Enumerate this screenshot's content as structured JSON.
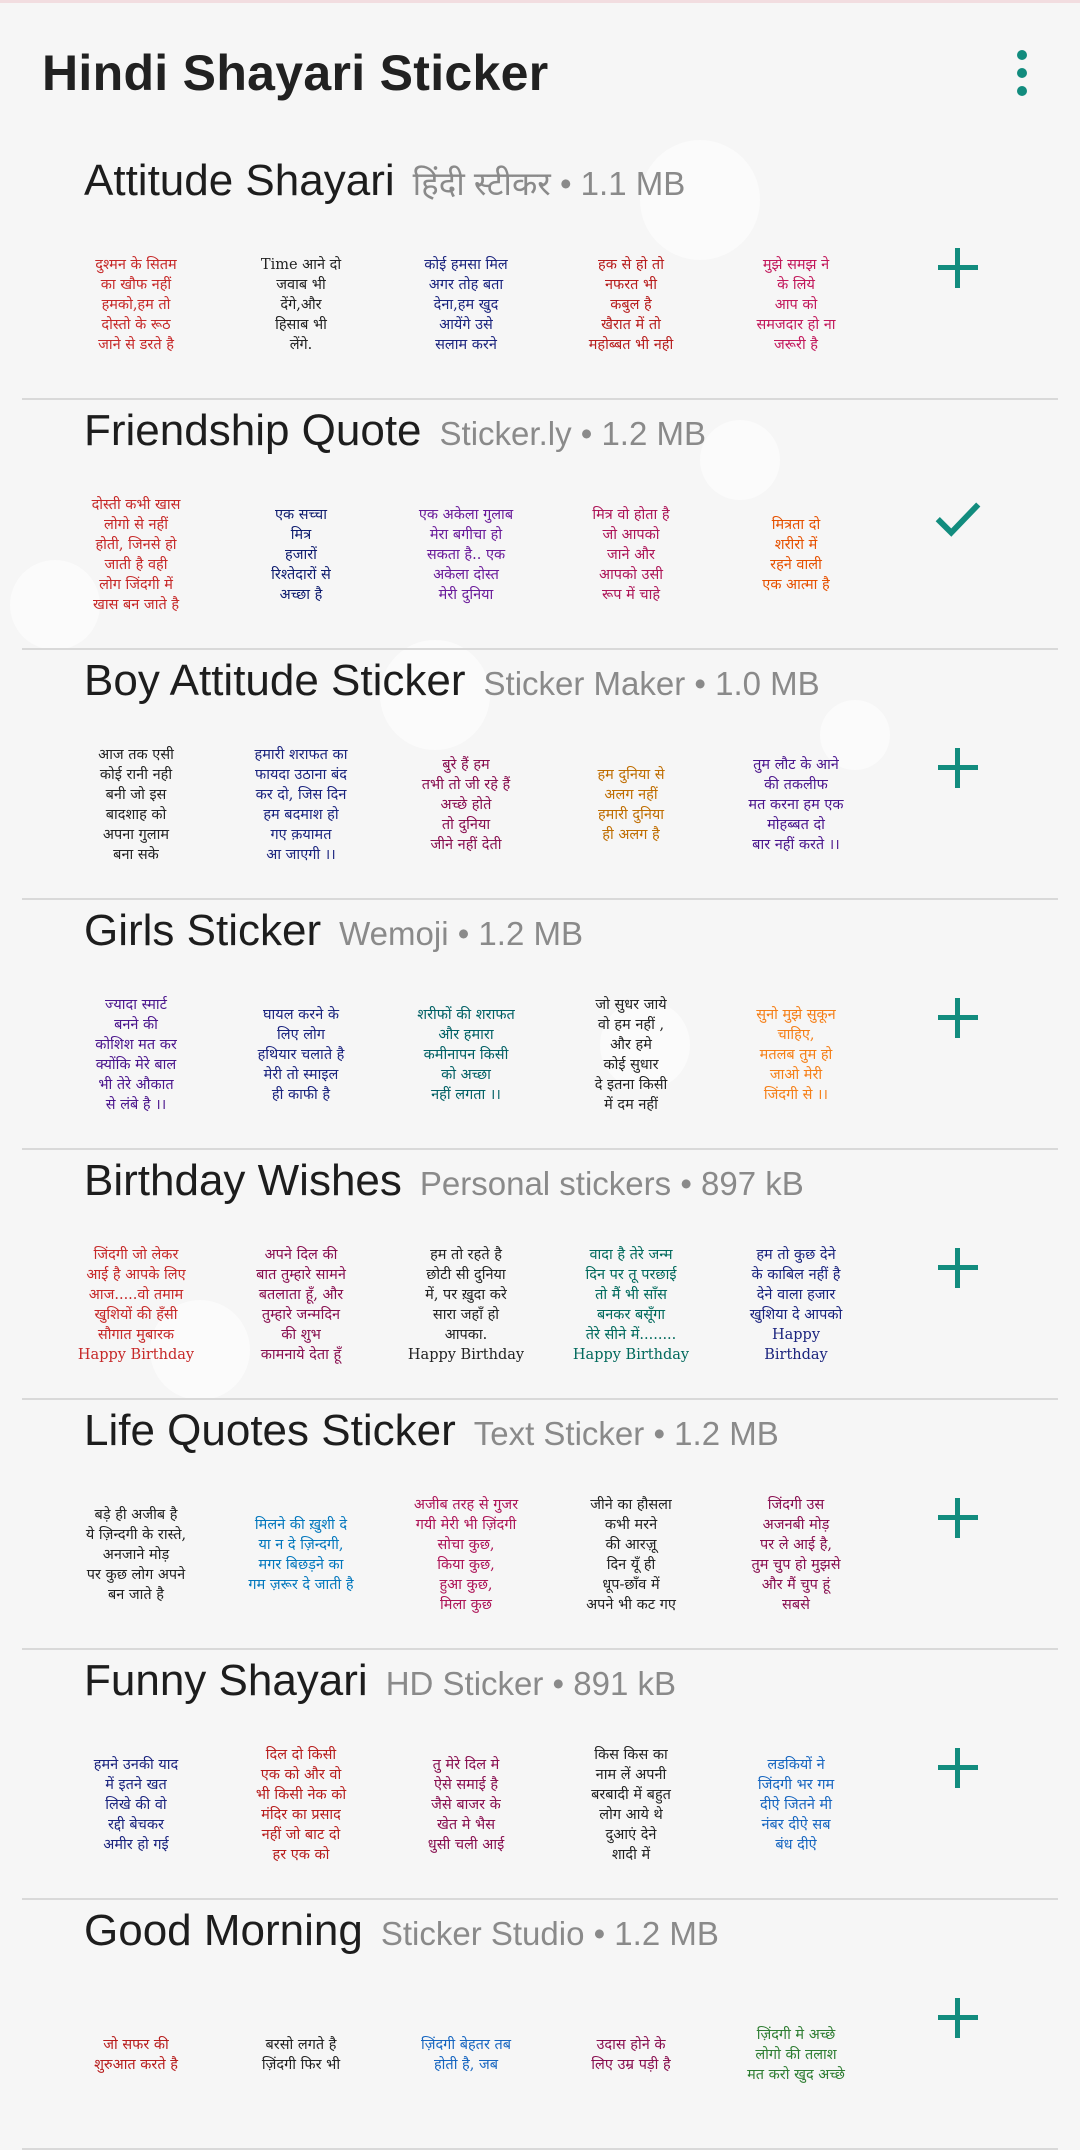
{
  "app": {
    "title": "Hindi Shayari Sticker"
  },
  "colors": {
    "accent": "#128c7e"
  },
  "packs": [
    {
      "name": "Attitude Shayari",
      "meta": "हिंदी स्टीकर • 1.1 MB",
      "status": "add",
      "stickers": [
        {
          "text": "दुश्मन के सितम\nका खौफ नहीं\nहमको,हम तो\nदोस्तो के रूठ\nजाने से डरते है",
          "color": "#c62828"
        },
        {
          "text": "Time आने दो\nजवाब भी\nदेंगे,और\nहिसाब भी\nलेंगे.",
          "color": "#222222"
        },
        {
          "text": "कोई हमसा मिल\nअगर तोह बता\nदेना,हम खुद\nआयेंगे उसे\nसलाम करने",
          "color": "#1a237e"
        },
        {
          "text": "हक से हो तो\nनफरत भी\nकबुल है\nखैरात में तो\nमहोब्बत भी नही",
          "color": "#b71c1c"
        },
        {
          "text": "मुझे समझ ने\nके लिये\nआप को\nसमजदार हो ना\nजरूरी है",
          "color": "#c2185b"
        }
      ]
    },
    {
      "name": "Friendship Quote",
      "meta": "Sticker.ly • 1.2 MB",
      "status": "added",
      "stickers": [
        {
          "text": "दोस्ती कभी खास\nलोगो से नहीं\nहोती, जिनसे हो\nजाती है वही\nलोग जिंदगी में\nखास बन जाते है",
          "color": "#c62828"
        },
        {
          "text": "एक सच्चा\nमित्र\nहजारों\nरिश्तेदारों से\nअच्छा है",
          "color": "#0d1b6e"
        },
        {
          "text": "एक अकेला गुलाब\nमेरा बगीचा हो\nसकता है.. एक\nअकेला दोस्त\nमेरी दुनिया",
          "color": "#6a1b9a"
        },
        {
          "text": "मित्र वो होता है\nजो आपको\nजाने और\nआपको उसी\nरूप में चाहे",
          "color": "#ad1457"
        },
        {
          "text": "मित्रता दो\nशरीरो में\nरहने वाली\nएक आत्मा है",
          "color": "#e65100"
        }
      ]
    },
    {
      "name": "Boy Attitude Sticker",
      "meta": "Sticker Maker • 1.0 MB",
      "status": "add",
      "stickers": [
        {
          "text": "आज तक एसी\nकोई रानी नही\nबनी जो इस\nबादशाह को\nअपना गुलाम\nबना सके",
          "color": "#222222"
        },
        {
          "text": "हमारी शराफत का\nफायदा उठाना बंद\nकर दो, जिस दिन\nहम बदमाश हो\nगए क़यामत\nआ जाएगी ।।",
          "color": "#1a237e"
        },
        {
          "text": "बुरे हैं हम\nतभी तो जी रहे हैं\nअच्छे होते\nतो दुनिया\nजीने नहीं देती",
          "color": "#880e4f"
        },
        {
          "text": "हम दुनिया से\nअलग नहीं\nहमारी दुनिया\nही अलग है",
          "color": "#bf6d00"
        },
        {
          "text": "तुम लौट के आने\nकी तकलीफ\nमत करना हम एक\nमोहब्बत दो\nबार नहीं करते ।।",
          "color": "#4a148c"
        }
      ]
    },
    {
      "name": "Girls Sticker",
      "meta": "Wemoji • 1.2 MB",
      "status": "add",
      "stickers": [
        {
          "text": "ज्यादा स्मार्ट\nबनने की\nकोशिश मत कर\nक्योंकि मेरे बाल\nभी तेरे औकात\nसे लंबे है ।।",
          "color": "#4a148c"
        },
        {
          "text": "घायल करने के\nलिए लोग\nहथियार चलाते है\nमेरी तो स्माइल\nही काफी है",
          "color": "#1a237e"
        },
        {
          "text": "शरीफों की शराफत\nऔर हमारा\nकमीनापन किसी\nको अच्छा\nनहीं लगता ।।",
          "color": "#006064"
        },
        {
          "text": "जो सुधर जाये\nवो हम नहीं ,\nऔर हमे\nकोई सुधार\nदे इतना किसी\nमें दम नहीं",
          "color": "#222222"
        },
        {
          "text": "सुनो मुझे सुकून\nचाहिए,\nमतलब तुम हो\nजाओ मेरी\nजिंदगी से ।।",
          "color": "#f57f17"
        }
      ]
    },
    {
      "name": "Birthday Wishes",
      "meta": "Personal stickers • 897 kB",
      "status": "add",
      "stickers": [
        {
          "text": "जिंदगी जो लेकर\nआई है आपके लिए\nआज.....वो तमाम\nखुशियों की हँसी\nसौगात मुबारक\nHappy Birthday",
          "color": "#c62828"
        },
        {
          "text": "अपने दिल की\nबात तुम्हारे सामने\nबतलाता हूँ, और\nतुम्हारे जन्मदिन\nकी शुभ\nकामनाये देता हूँ",
          "color": "#880e4f"
        },
        {
          "text": "हम तो रहते है\nछोटी सी दुनिया\nमें, पर ख़ुदा करे\nसारा जहाँ हो\nआपका.\nHappy Birthday",
          "color": "#222222"
        },
        {
          "text": "वादा है तेरे जन्म\nदिन पर तू परछाई\nतो मैं भी साँस\nबनकर बसूँगा\nतेरे सीने में........\nHappy Birthday",
          "color": "#00695c"
        },
        {
          "text": "हम तो कुछ देने\nके काबिल नहीं है\nदेने वाला हजार\nखुशिया दे आपको\nHappy\nBirthday",
          "color": "#1a237e"
        }
      ]
    },
    {
      "name": "Life Quotes Sticker",
      "meta": "Text Sticker • 1.2 MB",
      "status": "add",
      "stickers": [
        {
          "text": "बड़े ही अजीब है\nये ज़िन्दगी के रास्ते,\nअनजाने मोड़\nपर कुछ लोग अपने\nबन जाते है",
          "color": "#222222"
        },
        {
          "text": "मिलने की ख़ुशी दे\nया न दे ज़िन्दगी,\nमगर बिछड़ने का\nगम ज़रूर दे जाती है",
          "color": "#0277bd"
        },
        {
          "text": "अजीब तरह से गुजर\nगयी मेरी भी ज़िंदगी\nसोचा कुछ,\nकिया कुछ,\nहुआ कुछ,\nमिला कुछ",
          "color": "#ad1457"
        },
        {
          "text": "जीने का हौसला\nकभी मरने\nकी आरज़ू\nदिन यूँ ही\nधूप-छाँव में\nअपने भी कट गए",
          "color": "#222222"
        },
        {
          "text": "जिंदगी उस\nअजनबी मोड़\nपर ले आई है,\nतुम चुप हो मुझसे\nऔर मैं चुप हूं\nसबसे",
          "color": "#880e4f"
        }
      ]
    },
    {
      "name": "Funny Shayari",
      "meta": "HD Sticker • 891 kB",
      "status": "add",
      "stickers": [
        {
          "text": "हमने उनकी याद\nमें इतने खत\nलिखे की वो\nरद्दी बेचकर\nअमीर हो गई",
          "color": "#1a237e"
        },
        {
          "text": "दिल दो किसी\nएक को और वो\nभी किसी नेक को\nमंदिर का प्रसाद\nनहीं जो बाट दो\nहर एक को",
          "color": "#b71c1c"
        },
        {
          "text": "तु मेरे दिल मे\nऐसे समाई है\nजैसे बाजर के\nखेत मे भैस\nधुसी चली आई",
          "color": "#880e4f"
        },
        {
          "text": "किस किस का\nनाम लें अपनी\nबरबादी में बहुत\nलोग आये थे\nदुआएं देने\nशादी में",
          "color": "#222222"
        },
        {
          "text": "लडकियों ने\nजिंदगी भर गम\nदीऐ जितने मी\nनंबर दीऐ सब\nबंध दीऐ",
          "color": "#1565c0"
        }
      ]
    },
    {
      "name": "Good Morning",
      "meta": "Sticker Studio • 1.2 MB",
      "status": "add",
      "stickers": [
        {
          "text": "जो सफर की\nशुरुआत करते है",
          "color": "#b71c1c"
        },
        {
          "text": "बरसो लगते है\nज़िंदगी फिर भी",
          "color": "#222222"
        },
        {
          "text": "ज़िंदगी बेहतर तब\nहोती है, जब",
          "color": "#1565c0"
        },
        {
          "text": "उदास होने के\nलिए उम्र पड़ी है",
          "color": "#880e4f"
        },
        {
          "text": "ज़िंदगी मे अच्छे\nलोगो की तलाश\nमत करो खुद अच्छे",
          "color": "#2e7d32"
        }
      ]
    }
  ]
}
